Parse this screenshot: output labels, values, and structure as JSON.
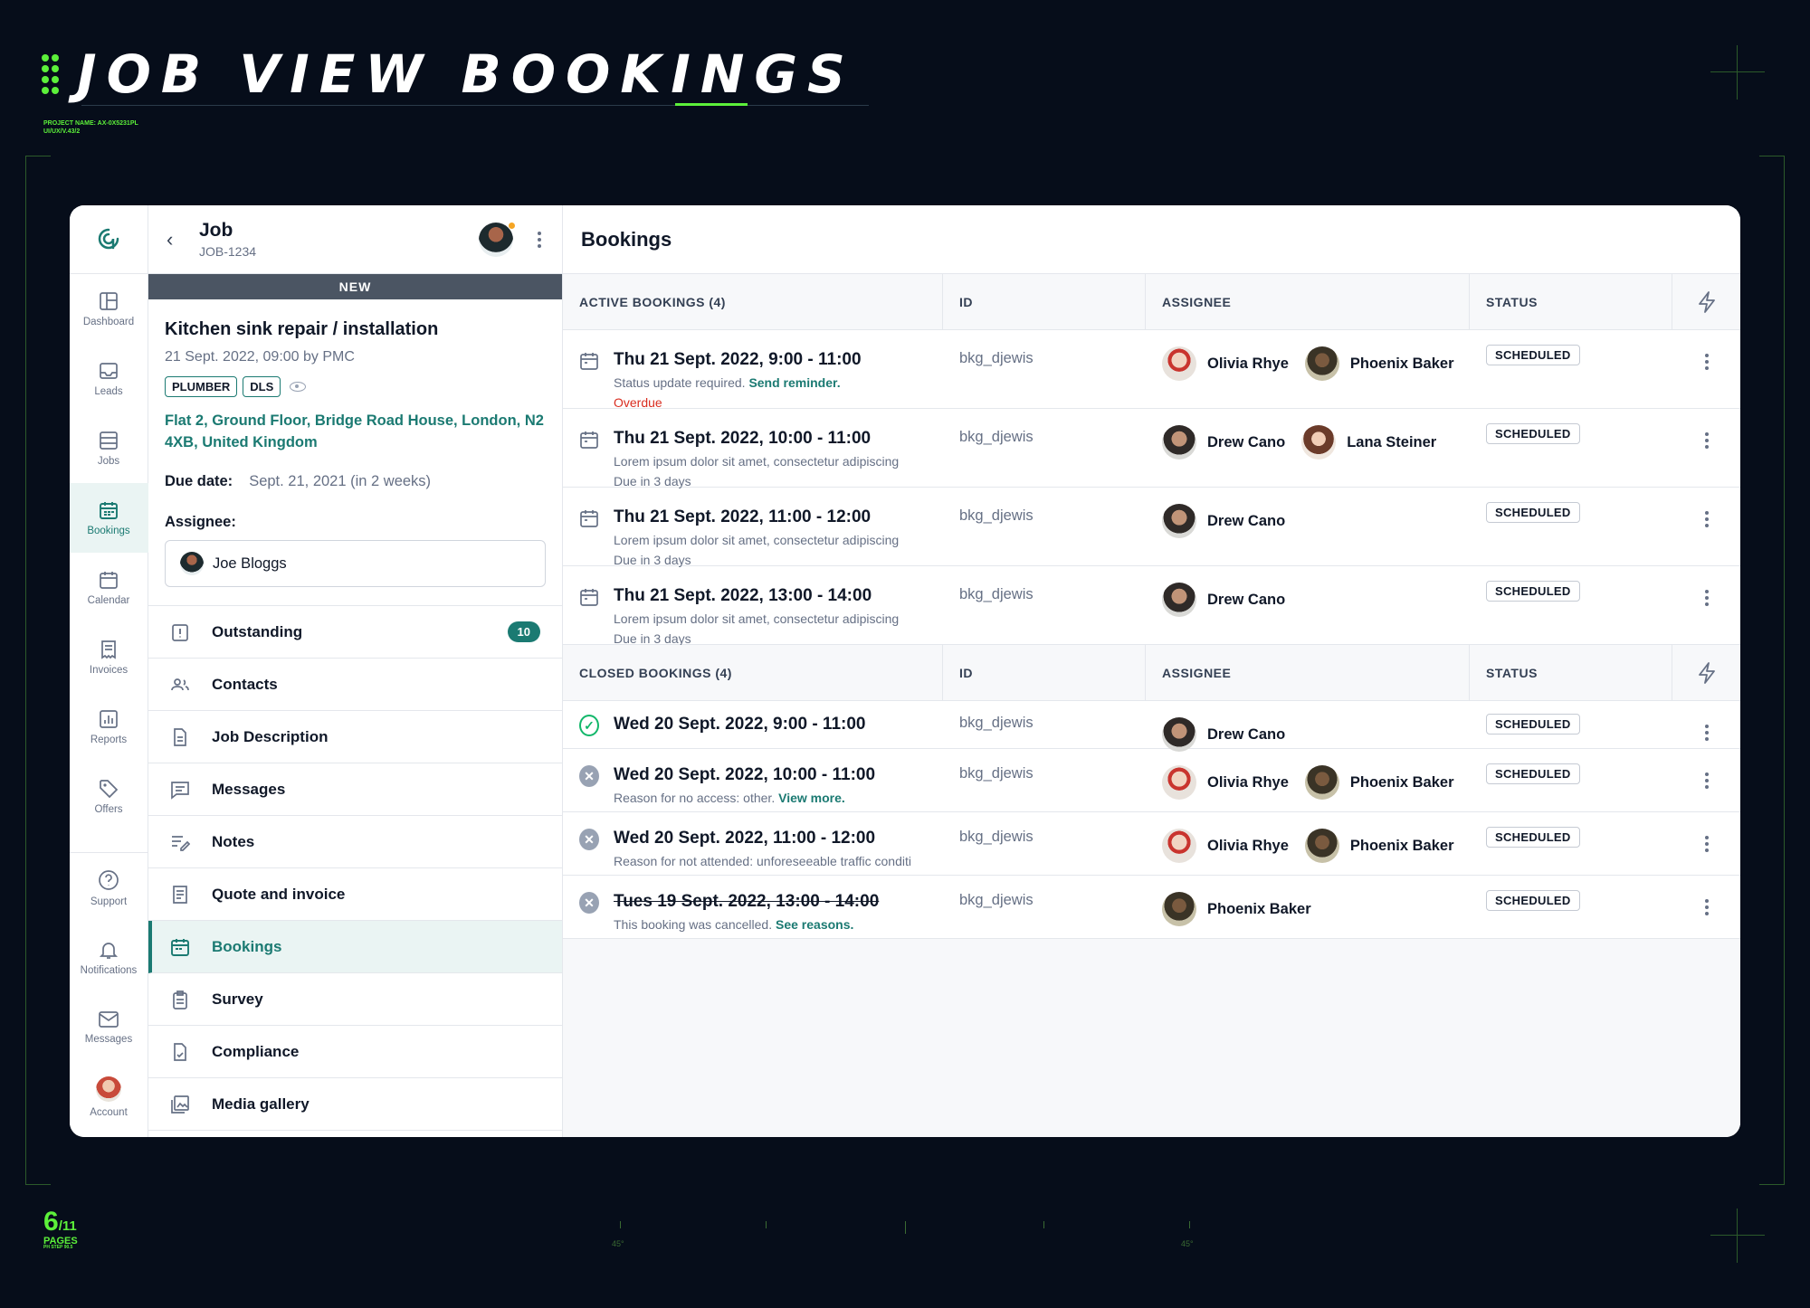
{
  "deco": {
    "heading": "JOB VIEW BOOKINGS",
    "project_line1": "PROJECT NAME: AX-0X5231PL",
    "project_line2": "UI/UX/V.43/2",
    "page_current": "6",
    "page_total": "/11",
    "pages_label": "PAGES",
    "pages_sub": "PH STEP 90.5",
    "deg_left": "45°",
    "deg_right": "45°",
    "accent": "#5cf03a"
  },
  "rail": {
    "logo_icon": "app-logo-icon",
    "items": [
      {
        "label": "Dashboard",
        "icon": "dashboard-icon"
      },
      {
        "label": "Leads",
        "icon": "inbox-icon"
      },
      {
        "label": "Jobs",
        "icon": "list-icon"
      },
      {
        "label": "Bookings",
        "icon": "calendar-icon"
      },
      {
        "label": "Calendar",
        "icon": "calendar-icon"
      },
      {
        "label": "Invoices",
        "icon": "receipt-icon"
      },
      {
        "label": "Reports",
        "icon": "chart-icon"
      },
      {
        "label": "Offers",
        "icon": "tag-icon"
      }
    ],
    "bottom": [
      {
        "label": "Support",
        "icon": "help-icon"
      },
      {
        "label": "Notifications",
        "icon": "bell-icon"
      },
      {
        "label": "Messages",
        "icon": "mail-icon"
      },
      {
        "label": "Account",
        "icon": "avatar"
      }
    ]
  },
  "job": {
    "title": "Job",
    "code": "JOB-1234",
    "status_bar": "NEW",
    "name": "Kitchen sink repair / installation",
    "meta": "21 Sept. 2022, 09:00 by PMC",
    "tags": [
      "PLUMBER",
      "DLS"
    ],
    "address": "Flat 2, Ground Floor, Bridge Road House, London, N2 4XB, United Kingdom",
    "due_label": "Due date:",
    "due_value": "Sept. 21, 2021 (in 2 weeks)",
    "assignee_label": "Assignee:",
    "assignee_name": "Joe Bloggs",
    "menu": [
      {
        "label": "Outstanding",
        "icon": "alert-icon",
        "count": "10"
      },
      {
        "label": "Contacts",
        "icon": "users-icon"
      },
      {
        "label": "Job Description",
        "icon": "file-icon"
      },
      {
        "label": "Messages",
        "icon": "message-icon"
      },
      {
        "label": "Notes",
        "icon": "edit-icon"
      },
      {
        "label": "Quote and invoice",
        "icon": "receipt-icon"
      },
      {
        "label": "Bookings",
        "icon": "calendar-icon"
      },
      {
        "label": "Survey",
        "icon": "clipboard-icon"
      },
      {
        "label": "Compliance",
        "icon": "document-icon"
      },
      {
        "label": "Media gallery",
        "icon": "image-icon"
      }
    ]
  },
  "bookings": {
    "title": "Bookings",
    "columns": {
      "id": "ID",
      "assignee": "ASSIGNEE",
      "status": "STATUS"
    },
    "active_label": "ACTIVE BOOKINGS (4)",
    "closed_label": "CLOSED BOOKINGS (4)",
    "active": [
      {
        "when": "Thu 21 Sept. 2022, 9:00 - 11:00",
        "sub": "Status update required.",
        "link": "Send reminder.",
        "extra": "Overdue",
        "extra_red": true,
        "id": "bkg_djewis",
        "people": [
          {
            "name": "Olivia Rhye",
            "av": "olivia"
          },
          {
            "name": "Phoenix Baker",
            "av": "phoenix"
          }
        ],
        "status": "SCHEDULED"
      },
      {
        "when": "Thu 21 Sept. 2022, 10:00 - 11:00",
        "sub": "Lorem ipsum dolor sit amet, consectetur adipiscing",
        "link": "",
        "extra": "Due in 3 days",
        "extra_red": false,
        "id": "bkg_djewis",
        "people": [
          {
            "name": "Drew Cano",
            "av": "drew"
          },
          {
            "name": "Lana Steiner",
            "av": "lana"
          }
        ],
        "status": "SCHEDULED"
      },
      {
        "when": "Thu 21 Sept. 2022, 11:00 - 12:00",
        "sub": "Lorem ipsum dolor sit amet, consectetur adipiscing",
        "link": "",
        "extra": "Due in 3 days",
        "extra_red": false,
        "id": "bkg_djewis",
        "people": [
          {
            "name": "Drew Cano",
            "av": "drew"
          }
        ],
        "status": "SCHEDULED"
      },
      {
        "when": "Thu 21 Sept. 2022, 13:00 - 14:00",
        "sub": "Lorem ipsum dolor sit amet, consectetur adipiscing",
        "link": "",
        "extra": "Due in 3 days",
        "extra_red": false,
        "id": "bkg_djewis",
        "people": [
          {
            "name": "Drew Cano",
            "av": "drew"
          }
        ],
        "status": "SCHEDULED"
      }
    ],
    "closed": [
      {
        "when": "Wed 20 Sept. 2022, 9:00 - 11:00",
        "state": "ok",
        "sub": "",
        "link": "",
        "strike": false,
        "id": "bkg_djewis",
        "people": [
          {
            "name": "Drew Cano",
            "av": "drew"
          }
        ],
        "status": "SCHEDULED"
      },
      {
        "when": "Wed 20 Sept. 2022, 10:00 - 11:00",
        "state": "x",
        "sub": "Reason for no access: other.",
        "link": "View more.",
        "strike": false,
        "id": "bkg_djewis",
        "people": [
          {
            "name": "Olivia Rhye",
            "av": "olivia"
          },
          {
            "name": "Phoenix Baker",
            "av": "phoenix"
          }
        ],
        "status": "SCHEDULED"
      },
      {
        "when": "Wed 20 Sept. 2022, 11:00 - 12:00",
        "state": "x",
        "sub": "Reason for not attended: unforeseeable traffic conditi",
        "link": "",
        "strike": false,
        "id": "bkg_djewis",
        "people": [
          {
            "name": "Olivia Rhye",
            "av": "olivia"
          },
          {
            "name": "Phoenix Baker",
            "av": "phoenix"
          }
        ],
        "status": "SCHEDULED"
      },
      {
        "when": "Tues 19 Sept. 2022, 13:00 - 14:00",
        "state": "x",
        "sub": "This booking was cancelled.",
        "link": "See reasons.",
        "strike": true,
        "id": "bkg_djewis",
        "people": [
          {
            "name": "Phoenix Baker",
            "av": "phoenix"
          }
        ],
        "status": "SCHEDULED"
      }
    ]
  }
}
